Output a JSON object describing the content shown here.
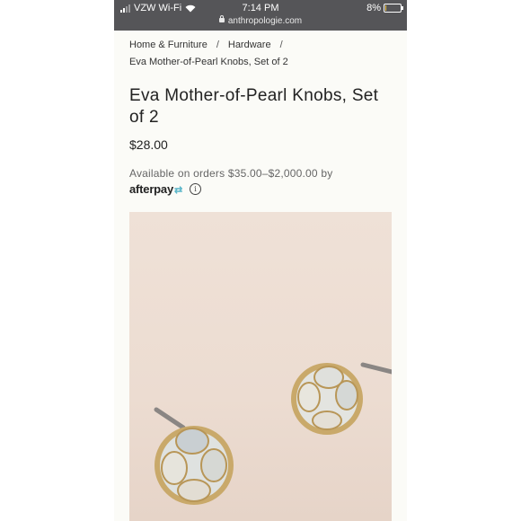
{
  "status_bar": {
    "carrier": "VZW Wi-Fi",
    "time": "7:14 PM",
    "url": "anthropologie.com",
    "battery": "8%",
    "battery_level": 0.08
  },
  "breadcrumb": {
    "items": [
      "Home & Furniture",
      "Hardware",
      "Eva Mother-of-Pearl Knobs, Set of 2"
    ],
    "separator": "/"
  },
  "product": {
    "title": "Eva Mother-of-Pearl Knobs, Set of 2",
    "price": "$28.00",
    "afterpay_text": "Available on orders $35.00–$2,000.00 by",
    "afterpay_brand": "afterpay",
    "info_icon": "info-icon"
  },
  "colors": {
    "status_bar_bg": "#555558",
    "page_bg": "#fbfbf7",
    "afterpay_accent": "#5ab6c9",
    "image_bg": "#efe1d7"
  }
}
